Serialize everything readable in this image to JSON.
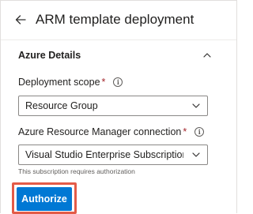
{
  "header": {
    "title": "ARM template deployment",
    "back_icon": "arrow-left-icon"
  },
  "section": {
    "title": "Azure Details",
    "collapse_icon": "chevron-up-icon"
  },
  "fields": {
    "deployment_scope": {
      "label": "Deployment scope",
      "required_mark": "*",
      "info_icon": "i",
      "value": "Resource Group"
    },
    "arm_connection": {
      "label": "Azure Resource Manager connection",
      "required_mark": "*",
      "info_icon": "i",
      "value": "Visual Studio Enterprise Subscription(ac...",
      "helper": "This subscription requires authorization"
    }
  },
  "actions": {
    "authorize_label": "Authorize"
  },
  "colors": {
    "accent": "#0078d4",
    "highlight": "#e35b48",
    "required": "#a4262c"
  }
}
